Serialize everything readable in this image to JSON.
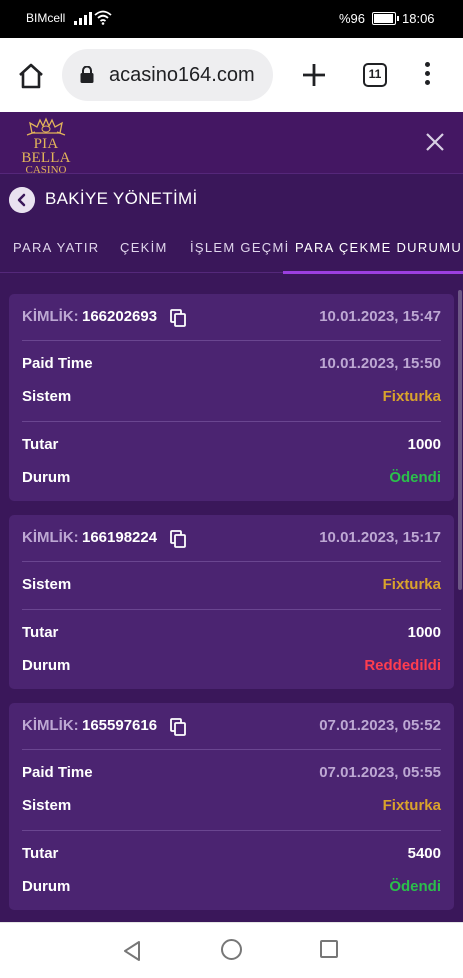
{
  "statusbar": {
    "carrier": "BIMcell",
    "battery": "%96",
    "time": "18:06"
  },
  "browser": {
    "url": "acasino164.com",
    "tab_count": "11"
  },
  "app": {
    "logo_brand": "PIA BELLA",
    "logo_sub": "CASINO",
    "page_title": "BAKİYE YÖNETİMİ",
    "tabs": [
      "PARA YATIR",
      "ÇEKİM",
      "İŞLEM GEÇMİ",
      "PARA ÇEKME DURUMU"
    ],
    "active_tab": "PARA ÇEKME DURUMU"
  },
  "labels": {
    "id": "KİMLİK:",
    "paid_time": "Paid Time",
    "system": "Sistem",
    "amount": "Tutar",
    "status": "Durum"
  },
  "withdrawals": [
    {
      "id": "166202693",
      "date": "10.01.2023, 15:47",
      "paid_time": "10.01.2023, 15:50",
      "system": "Fixturka",
      "amount": "1000",
      "status": "Ödendi"
    },
    {
      "id": "166198224",
      "date": "10.01.2023, 15:17",
      "system": "Fixturka",
      "amount": "1000",
      "status": "Reddedildi"
    },
    {
      "id": "165597616",
      "date": "07.01.2023, 05:52",
      "paid_time": "07.01.2023, 05:55",
      "system": "Fixturka",
      "amount": "5400",
      "status": "Ödendi"
    }
  ],
  "colors": {
    "background": "#3a175a",
    "card": "#4b2471",
    "system": "#d9a32c",
    "paid": "#2bc04b",
    "rejected": "#ff3d4f",
    "tab_indicator": "#9b3fe0",
    "logo_gold": "#e2b45a"
  }
}
